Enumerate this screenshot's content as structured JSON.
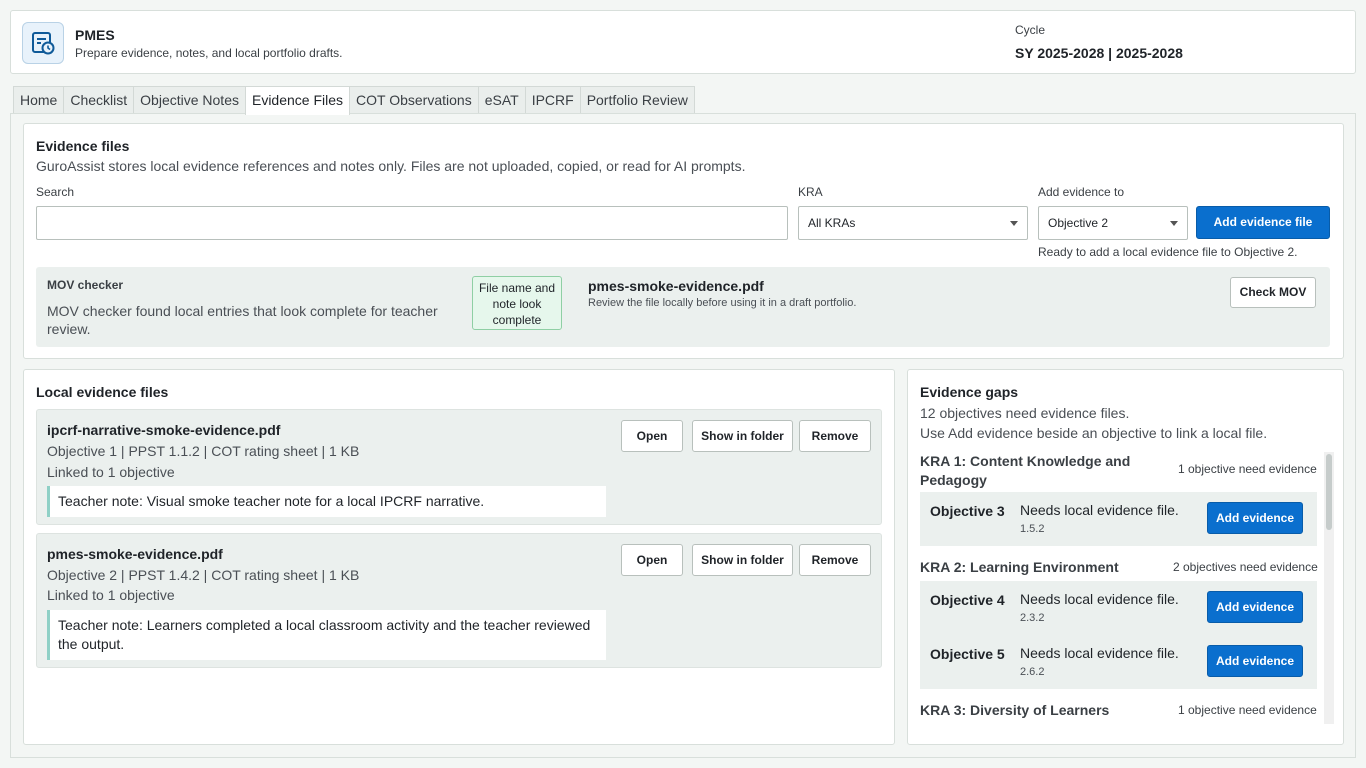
{
  "app": {
    "name": "PMES",
    "subtitle": "Prepare evidence, notes, and local portfolio drafts.",
    "icon": "planner-clock-icon",
    "cycle_label": "Cycle",
    "cycle_value": "SY 2025-2028 | 2025-2028"
  },
  "tabs": [
    {
      "label": "Home"
    },
    {
      "label": "Checklist"
    },
    {
      "label": "Objective Notes"
    },
    {
      "label": "Evidence Files",
      "active": true
    },
    {
      "label": "COT Observations"
    },
    {
      "label": "eSAT"
    },
    {
      "label": "IPCRF"
    },
    {
      "label": "Portfolio Review"
    }
  ],
  "evidence": {
    "title": "Evidence files",
    "description": "GuroAssist stores local evidence references and notes only. Files are not uploaded, copied, or read for AI prompts.",
    "search_label": "Search",
    "search_value": "",
    "kra_label": "KRA",
    "kra_value": "All KRAs",
    "add_to_label": "Add evidence to",
    "add_to_value": "Objective 2",
    "add_button": "Add evidence file",
    "ready_text": "Ready to add a local evidence file to Objective 2."
  },
  "mov": {
    "title": "MOV checker",
    "message": "MOV checker found local entries that look complete for teacher review.",
    "status_pill": "File name and note look complete",
    "file_name": "pmes-smoke-evidence.pdf",
    "file_hint": "Review the file locally before using it in a draft portfolio.",
    "check_button": "Check MOV"
  },
  "local_files": {
    "title": "Local evidence files",
    "open_label": "Open",
    "show_label": "Show in folder",
    "remove_label": "Remove",
    "items": [
      {
        "name": "ipcrf-narrative-smoke-evidence.pdf",
        "meta": "Objective 1 | PPST 1.1.2 | COT rating sheet | 1 KB",
        "linked": "Linked to 1 objective",
        "note": "Teacher note: Visual smoke teacher note for a local IPCRF narrative."
      },
      {
        "name": "pmes-smoke-evidence.pdf",
        "meta": "Objective 2 | PPST 1.4.2 | COT rating sheet | 1 KB",
        "linked": "Linked to 1 objective",
        "note": "Teacher note: Learners completed a local classroom activity and the teacher reviewed the output."
      }
    ]
  },
  "gaps": {
    "title": "Evidence gaps",
    "summary": "12 objectives need evidence files.",
    "hint": "Use Add evidence beside an objective to link a local file.",
    "add_label": "Add evidence",
    "need_text": "Needs local evidence file.",
    "kras": [
      {
        "title": "KRA 1: Content Knowledge and Pedagogy",
        "count": "1 objective need evidence",
        "objectives": [
          {
            "name": "Objective 3",
            "code": "1.5.2"
          }
        ]
      },
      {
        "title": "KRA 2: Learning Environment",
        "count": "2 objectives need evidence",
        "objectives": [
          {
            "name": "Objective 4",
            "code": "2.3.2"
          },
          {
            "name": "Objective 5",
            "code": "2.6.2"
          }
        ]
      },
      {
        "title": "KRA 3: Diversity of Learners",
        "count": "1 objective need evidence",
        "objectives": []
      }
    ]
  }
}
